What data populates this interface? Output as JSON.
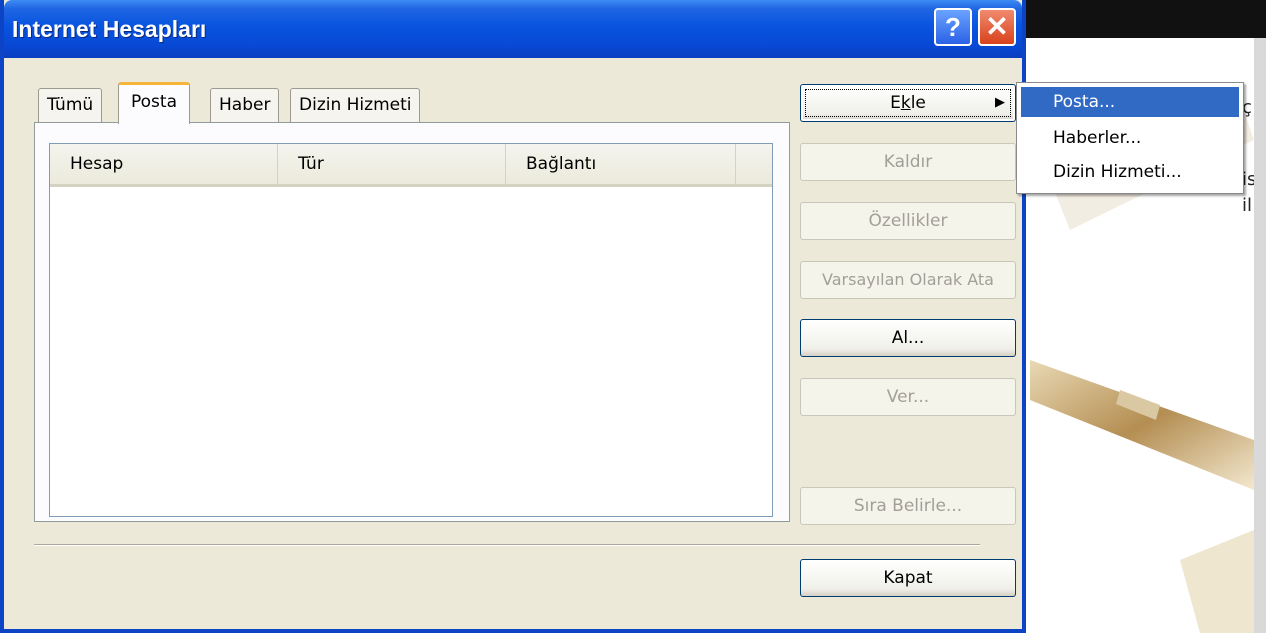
{
  "window": {
    "title": "Internet Hesapları",
    "help_glyph": "?",
    "close_glyph": "✕"
  },
  "tabs": [
    {
      "label": "Tümü",
      "active": false
    },
    {
      "label": "Posta",
      "active": true
    },
    {
      "label": "Haber",
      "active": false
    },
    {
      "label": "Dizin Hizmeti",
      "active": false
    }
  ],
  "list": {
    "columns": [
      "Hesap",
      "Tür",
      "Bağlantı"
    ],
    "rows": []
  },
  "buttons": {
    "add": {
      "pre": "E",
      "accel": "k",
      "post": "le",
      "arrow": "▶"
    },
    "remove": "Kaldır",
    "properties": "Özellikler",
    "set_default": "Varsayılan Olarak Ata",
    "import": "Al...",
    "export": "Ver...",
    "set_order": "Sıra Belirle...",
    "close": "Kapat"
  },
  "add_menu": {
    "items": [
      "Posta...",
      "Haberler...",
      "Dizin Hizmeti..."
    ],
    "selected_index": 0
  },
  "background_app": {
    "fragments": [
      "ç",
      "is",
      "il"
    ]
  },
  "colors": {
    "titlebar": "#0854e0",
    "dialog_face": "#ece9d8",
    "tab_highlight": "#f6b53a",
    "menu_highlight": "#316ac5"
  }
}
